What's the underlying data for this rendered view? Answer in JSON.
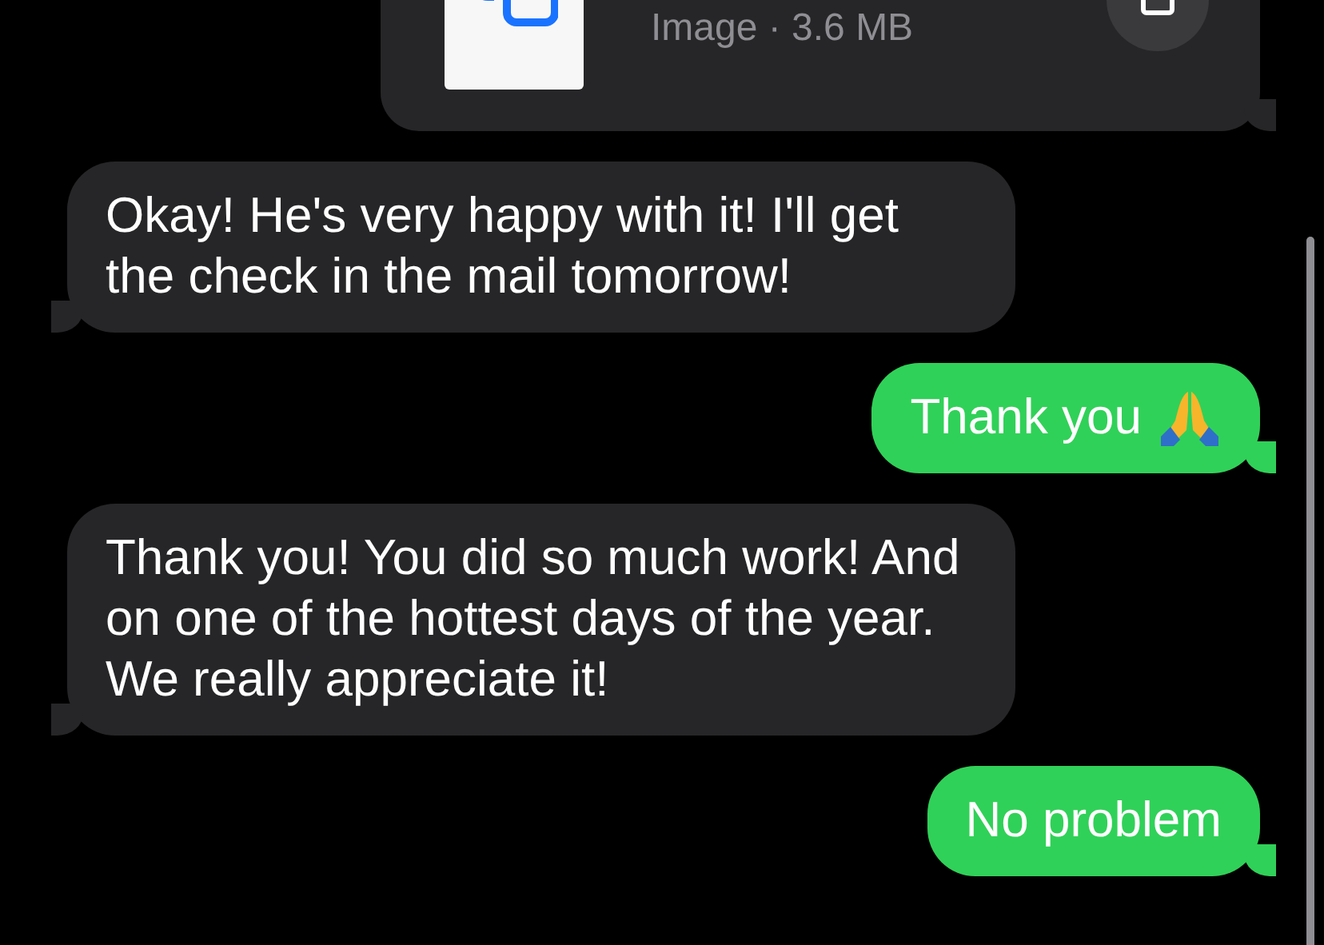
{
  "messages": [
    {
      "kind": "attachment",
      "sent": true,
      "detail": "Image · 3.6 MB"
    },
    {
      "kind": "text",
      "sent": false,
      "text": "Okay! He's very happy with it! I'll get the check in the mail tomorrow!",
      "emoji": false
    },
    {
      "kind": "text",
      "sent": true,
      "text": "Thank you",
      "emoji": true
    },
    {
      "kind": "text",
      "sent": false,
      "text": "Thank you! You did so much work! And on one of the hottest days of the year. We really appreciate it!",
      "emoji": false
    },
    {
      "kind": "text",
      "sent": true,
      "text": "No problem",
      "emoji": false
    }
  ]
}
